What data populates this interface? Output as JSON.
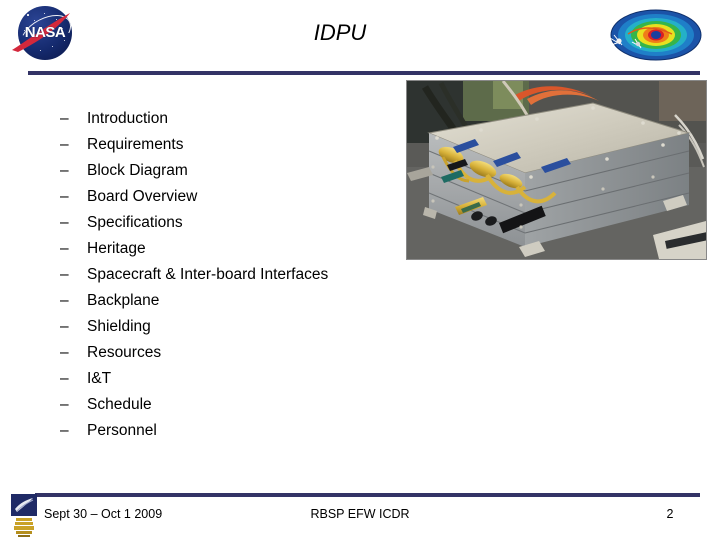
{
  "slide": {
    "title": "IDPU",
    "page_number": "2"
  },
  "logos": {
    "nasa": {
      "name": "nasa-meatball-logo",
      "wordmark": "NASA",
      "sphere_color": "#152a6e",
      "swoosh_color": "#d4283c",
      "text_color": "#ffffff"
    },
    "rbsp": {
      "name": "rbsp-radiation-belt-logo",
      "band_colors": [
        "#1b53a8",
        "#1fa0d8",
        "#36b54a",
        "#e8e020",
        "#f07d18",
        "#d81f26"
      ]
    },
    "ssl": {
      "name": "berkeley-ssl-seal",
      "shield_color": "#1f2a66",
      "accent_color": "#c9a227"
    }
  },
  "theme": {
    "rule_color": "#333366",
    "background": "#ffffff",
    "text_color": "#000000"
  },
  "outline": {
    "dash": "–",
    "items": [
      "Introduction",
      "Requirements",
      "Block Diagram",
      "Board Overview",
      "Specifications",
      "Heritage",
      "Spacecraft & Inter-board Interfaces",
      "Backplane",
      "Shielding",
      "Resources",
      "I&T",
      "Schedule",
      "Personnel"
    ]
  },
  "photo": {
    "name": "idpu-hardware-photo",
    "caption": "IDPU chassis with gold connector harnesses"
  },
  "footer": {
    "date": "Sept 30 – Oct 1 2009",
    "center": "RBSP EFW ICDR",
    "page": "2"
  }
}
